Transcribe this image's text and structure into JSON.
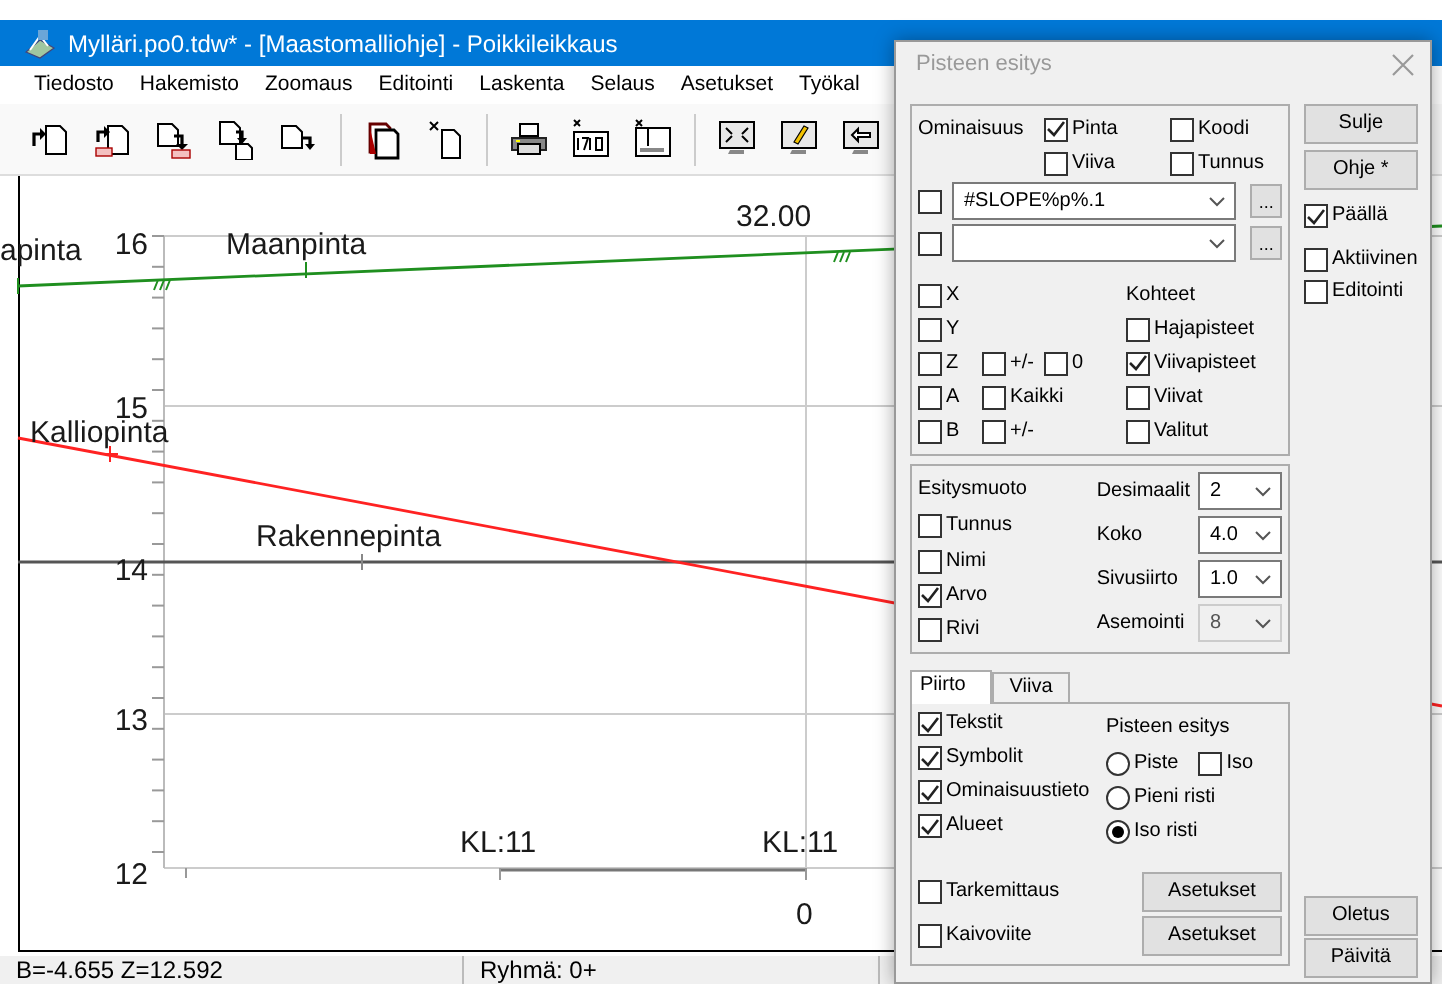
{
  "window": {
    "title": "Mylläri.po0.tdw* - [Maastomalliohje] - Poikkileikkaus"
  },
  "menu": [
    "Tiedosto",
    "Hakemisto",
    "Zoomaus",
    "Editointi",
    "Laskenta",
    "Selaus",
    "Asetukset",
    "Työkal"
  ],
  "section_view": {
    "y_ticks": [
      "16",
      "15",
      "14",
      "13",
      "12"
    ],
    "labels": [
      {
        "text": "32.00"
      },
      {
        "text": "apinta"
      },
      {
        "text": "Maanpinta"
      },
      {
        "text": "Kalliopinta"
      },
      {
        "text": "Rakennepinta"
      },
      {
        "text": "KL:11"
      },
      {
        "text": "KL:11"
      },
      {
        "text": "0"
      }
    ]
  },
  "status_bar": [
    "B=-4.655  Z=12.592",
    "Ryhmä: 0+"
  ],
  "dialog": {
    "title": "Pisteen esitys",
    "properties": {
      "label": "Ominaisuus",
      "options": [
        {
          "label": "Pinta",
          "checked": true
        },
        {
          "label": "Koodi",
          "checked": false
        },
        {
          "label": "Viiva",
          "checked": false
        },
        {
          "label": "Tunnus",
          "checked": false
        }
      ]
    },
    "formats": [
      {
        "checked": false,
        "value": "#SLOPE%p%.1",
        "button": "..."
      },
      {
        "checked": false,
        "button": "..."
      }
    ],
    "coords": [
      {
        "label": "X",
        "checked": false
      },
      {
        "label": "Y",
        "checked": false
      },
      {
        "label": "Z",
        "checked": false,
        "extras": [
          {
            "label": "+/-",
            "checked": false
          },
          {
            "label": "0",
            "checked": false
          }
        ]
      },
      {
        "label": "A",
        "checked": false,
        "extras": [
          {
            "label": "Kaikki",
            "checked": false
          }
        ]
      },
      {
        "label": "B",
        "checked": false,
        "extras": [
          {
            "label": "+/-",
            "checked": false
          }
        ]
      }
    ],
    "targets": {
      "heading": "Kohteet",
      "items": [
        {
          "label": "Hajapisteet",
          "checked": false
        },
        {
          "label": "Viivapisteet",
          "checked": true
        },
        {
          "label": "Viivat",
          "checked": false
        },
        {
          "label": "Valitut",
          "checked": false
        }
      ]
    },
    "display": {
      "heading": "Esitysmuoto",
      "items": [
        {
          "label": "Tunnus",
          "checked": false
        },
        {
          "label": "Nimi",
          "checked": false
        },
        {
          "label": "Arvo",
          "checked": true
        },
        {
          "label": "Rivi",
          "checked": false
        }
      ],
      "settings": [
        {
          "label": "Desimaalit",
          "value": "2",
          "disabled": false
        },
        {
          "label": "Koko",
          "value": "4.0",
          "disabled": false
        },
        {
          "label": "Sivusiirto",
          "value": "1.0",
          "disabled": false
        },
        {
          "label": "Asemointi",
          "value": "8",
          "disabled": true
        }
      ]
    },
    "tabs": [
      {
        "label": "Piirto",
        "selected": true
      },
      {
        "label": "Viiva",
        "selected": false
      }
    ],
    "drawing": {
      "items": [
        {
          "label": "Tekstit",
          "checked": true
        },
        {
          "label": "Symbolit",
          "checked": true
        },
        {
          "label": "Ominaisuustieto",
          "checked": true
        },
        {
          "label": "Alueet",
          "checked": true
        }
      ],
      "point_style": {
        "heading": "Pisteen esitys",
        "options": [
          {
            "label": "Piste",
            "selected": false
          },
          {
            "label": "Pieni risti",
            "selected": false
          },
          {
            "label": "Iso risti",
            "selected": true
          }
        ],
        "large": {
          "label": "Iso",
          "checked": false
        }
      },
      "extras": [
        {
          "label": "Tarkemittaus",
          "checked": false,
          "button": "Asetukset"
        },
        {
          "label": "Kaivoviite",
          "checked": false,
          "button": "Asetukset"
        }
      ]
    },
    "side_buttons": [
      "Sulje",
      "Ohje *"
    ],
    "side_checks": [
      {
        "label": "Päällä",
        "checked": true
      },
      {
        "label": "Aktiivinen",
        "checked": false
      },
      {
        "label": "Editointi",
        "checked": false
      }
    ],
    "bottom_buttons": [
      "Oletus",
      "Päivitä"
    ]
  }
}
